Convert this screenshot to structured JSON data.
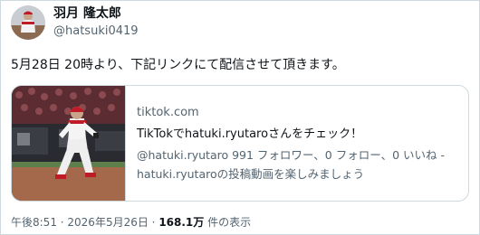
{
  "user": {
    "display_name": "羽月 隆太郎",
    "handle": "@hatsuki0419"
  },
  "tweet": {
    "text": "5月28日 20時より、下記リンクにて配信させて頂きます。"
  },
  "card": {
    "domain": "tiktok.com",
    "title": "TikTokでhatuki.ryutaroさんをチェック！",
    "description_line1": "@hatuki.ryutaro 991 フォロワー、0 フォロー、0 いいね -",
    "description_line2": "hatuki.ryutaroの投稿動画を楽しみましょう"
  },
  "meta": {
    "time": "午後8:51",
    "separator": " · ",
    "date": "2026年5月26日",
    "separator2": " · ",
    "views_count": "168.1万",
    "views_label": " 件の表示"
  }
}
